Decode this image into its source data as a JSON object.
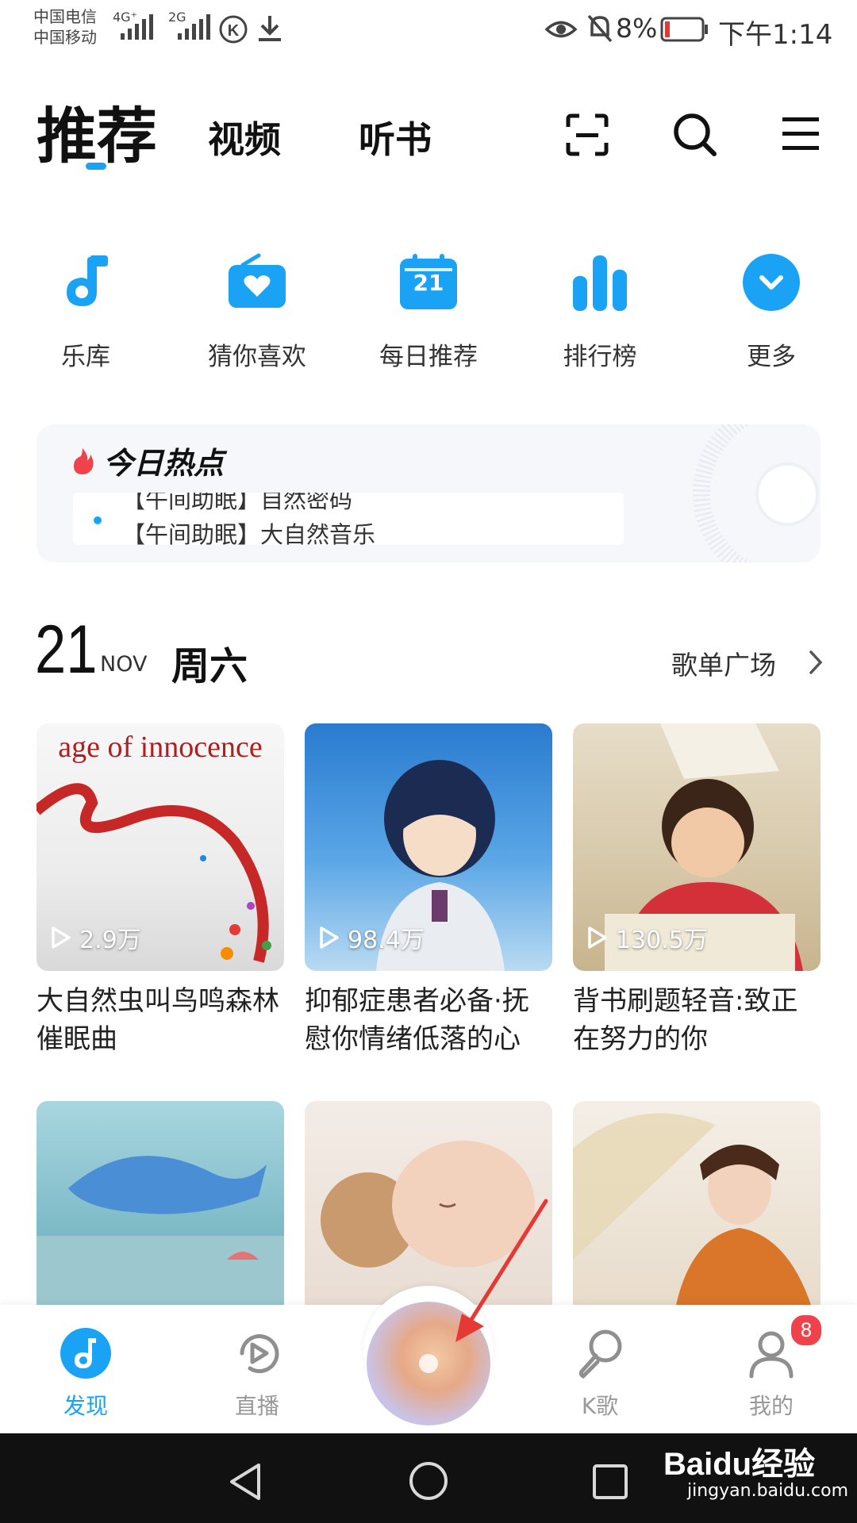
{
  "status_bar": {
    "carrier1": "中国电信",
    "carrier2": "中国移动",
    "net1": "4G⁺",
    "net2": "2G",
    "battery": "8%",
    "time": "下午1:14"
  },
  "header": {
    "tabs": [
      {
        "label": "推荐"
      },
      {
        "label": "视频"
      },
      {
        "label": "听书"
      }
    ],
    "icons": [
      "scan-icon",
      "search-icon",
      "menu-icon"
    ]
  },
  "quick_nav": {
    "items": [
      {
        "label": "乐库",
        "icon": "music-note-icon"
      },
      {
        "label": "猜你喜欢",
        "icon": "radio-heart-icon"
      },
      {
        "label": "每日推荐",
        "icon": "calendar-icon",
        "day": "21"
      },
      {
        "label": "排行榜",
        "icon": "chart-bars-icon"
      },
      {
        "label": "更多",
        "icon": "chevron-down-icon"
      }
    ]
  },
  "hot": {
    "title": "今日热点",
    "line1": "【午间助眠】自然密码",
    "line2": "【午间助眠】大自然音乐"
  },
  "date": {
    "day": "21",
    "month": "NOV",
    "weekday": "周六",
    "more_label": "歌单广场"
  },
  "playlists": [
    {
      "title": "大自然虫叫鸟鸣森林催眠曲",
      "plays": "2.9万",
      "cover_text": "age of innocence"
    },
    {
      "title": "抑郁症患者必备·抚慰你情绪低落的心",
      "plays": "98.4万"
    },
    {
      "title": "背书刷题轻音:致正在努力的你",
      "plays": "130.5万"
    }
  ],
  "bottom_nav": {
    "items": [
      {
        "label": "发现",
        "icon": "discover-icon",
        "active": true
      },
      {
        "label": "直播",
        "icon": "live-play-icon"
      },
      {
        "label": "K歌",
        "icon": "karaoke-mic-icon"
      },
      {
        "label": "我的",
        "icon": "profile-icon",
        "badge": "8"
      }
    ]
  },
  "watermark": {
    "brand": "Baidu经验",
    "url": "jingyan.baidu.com"
  },
  "colors": {
    "accent": "#1aa3f5",
    "badge": "#f0424a"
  }
}
